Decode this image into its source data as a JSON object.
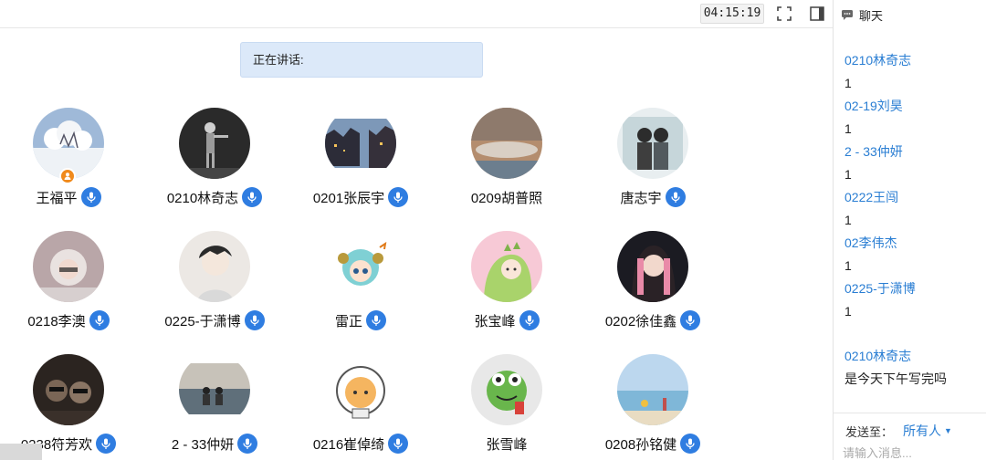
{
  "toolbar": {
    "timer": "04:15:19",
    "fullscreen_icon": "fullscreen-icon",
    "layout_icon": "sidebar-toggle-icon"
  },
  "speaking": {
    "label": "正在讲话:"
  },
  "participants": [
    {
      "name": "王福平",
      "host": true,
      "mic": true,
      "avatar": "snow-tree"
    },
    {
      "name": "0210林奇志",
      "host": false,
      "mic": true,
      "avatar": "dark-figure"
    },
    {
      "name": "0201张辰宇",
      "host": false,
      "mic": true,
      "avatar": "street-night"
    },
    {
      "name": "0209胡普照",
      "host": false,
      "mic": false,
      "avatar": "sky-cloud"
    },
    {
      "name": "唐志宇",
      "host": false,
      "mic": true,
      "avatar": "couple-photo"
    },
    {
      "name": "0218李澳",
      "host": false,
      "mic": true,
      "avatar": "winter-girl"
    },
    {
      "name": "0225-于潇博",
      "host": false,
      "mic": true,
      "avatar": "anime-boy"
    },
    {
      "name": "雷正",
      "host": false,
      "mic": true,
      "avatar": "cartoon-girl"
    },
    {
      "name": "张宝峰",
      "host": false,
      "mic": true,
      "avatar": "dino-costume"
    },
    {
      "name": "0202徐佳鑫",
      "host": false,
      "mic": true,
      "avatar": "girl-portrait"
    },
    {
      "name": "0238符芳欢",
      "host": false,
      "mic": true,
      "avatar": "car-selfie"
    },
    {
      "name": "2 - 33仲妍",
      "host": false,
      "mic": true,
      "avatar": "lake-couple"
    },
    {
      "name": "0216崔倬绮",
      "host": false,
      "mic": true,
      "avatar": "cat-astronaut"
    },
    {
      "name": "张雪峰",
      "host": false,
      "mic": false,
      "avatar": "frog-cartoon"
    },
    {
      "name": "0208孙铭健",
      "host": false,
      "mic": true,
      "avatar": "seaside-scene"
    }
  ],
  "sidebar": {
    "title": "聊天",
    "messages": [
      {
        "sender": "0210林奇志",
        "text": "1"
      },
      {
        "sender": "02-19刘昊",
        "text": "1"
      },
      {
        "sender": "2 - 33仲妍",
        "text": "1"
      },
      {
        "sender": "0222王闯",
        "text": "1"
      },
      {
        "sender": "02李伟杰",
        "text": "1"
      },
      {
        "sender": "0225-于潇博",
        "text": "1"
      }
    ],
    "last_message": {
      "sender": "0210林奇志",
      "text": "是今天下午写完吗"
    },
    "send_to_label": "发送至：",
    "send_to_value": "所有人",
    "input_placeholder": "请输入消息..."
  },
  "colors": {
    "accent": "#2f7de1",
    "link": "#2a7ed3",
    "host": "#f08a1c",
    "speaking_bg": "#dce9f9"
  }
}
